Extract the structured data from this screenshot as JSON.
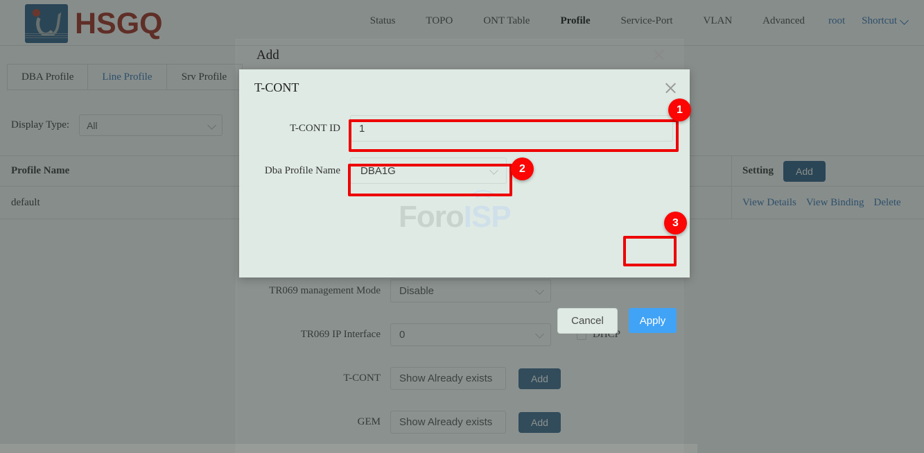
{
  "brand": {
    "name": "HSGQ"
  },
  "nav": {
    "items": [
      {
        "label": "Status",
        "active": false
      },
      {
        "label": "TOPO",
        "active": false
      },
      {
        "label": "ONT Table",
        "active": false
      },
      {
        "label": "Profile",
        "active": true
      },
      {
        "label": "Service-Port",
        "active": false
      },
      {
        "label": "VLAN",
        "active": false
      },
      {
        "label": "Advanced",
        "active": false
      }
    ],
    "user": "root",
    "shortcut": "Shortcut"
  },
  "tabs": [
    {
      "label": "DBA Profile",
      "active": false
    },
    {
      "label": "Line Profile",
      "active": true
    },
    {
      "label": "Srv Profile",
      "active": false
    }
  ],
  "filter": {
    "label": "Display Type:",
    "value": "All"
  },
  "table": {
    "headers": {
      "name": "Profile Name",
      "setting": "Setting"
    },
    "add_button": "Add",
    "rows": [
      {
        "name": "default",
        "actions": [
          "View Details",
          "View Binding",
          "Delete"
        ]
      }
    ]
  },
  "background_form": {
    "rows": [
      {
        "label": "TR069 management Mode",
        "value": "Disable",
        "type": "select"
      },
      {
        "label": "TR069 IP Interface",
        "value": "0",
        "type": "select",
        "checkbox_label": "DHCP"
      },
      {
        "label": "T-CONT",
        "value": "Show Already exists",
        "type": "text",
        "button": "Add"
      },
      {
        "label": "GEM",
        "value": "Show Already exists",
        "type": "text",
        "button": "Add"
      }
    ]
  },
  "add_dialog": {
    "title": "Add",
    "close_icon": "close-icon"
  },
  "tcont_dialog": {
    "title": "T-CONT",
    "close_icon": "close-icon",
    "fields": [
      {
        "label": "T-CONT ID",
        "value": "1",
        "type": "input"
      },
      {
        "label": "Dba Profile Name",
        "value": "DBA1G",
        "type": "select"
      }
    ],
    "buttons": {
      "cancel": "Cancel",
      "apply": "Apply"
    }
  },
  "watermark": {
    "part_a": "Foro",
    "part_b": "ISP"
  },
  "annotations": {
    "badges": [
      {
        "number": "1",
        "target": "tcont-id-input"
      },
      {
        "number": "2",
        "target": "dba-profile-select"
      },
      {
        "number": "3",
        "target": "apply-button"
      }
    ],
    "highlight_color": "#ee0000",
    "badge_color": "#fb0505"
  },
  "colors": {
    "brand_red": "#a52a1e",
    "brand_blue": "#2d5b86",
    "link_blue": "#3573b9",
    "apply_blue": "#41a3f5",
    "dialog_bg": "#dfeae4"
  }
}
